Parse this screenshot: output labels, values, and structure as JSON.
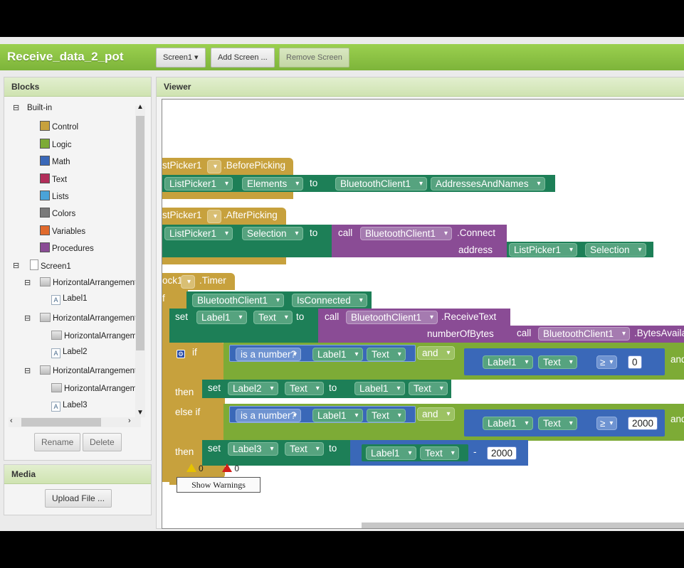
{
  "project": {
    "name": "Receive_data_2_pot"
  },
  "toolbar": {
    "screen_select": "Screen1 ▾",
    "add_screen": "Add Screen ...",
    "remove_screen": "Remove Screen"
  },
  "blocks_panel": {
    "title": "Blocks",
    "builtin_label": "Built-in",
    "builtin": [
      {
        "label": "Control",
        "color": "#c7a13d"
      },
      {
        "label": "Logic",
        "color": "#7dab36"
      },
      {
        "label": "Math",
        "color": "#3a68b8"
      },
      {
        "label": "Text",
        "color": "#b22e5a"
      },
      {
        "label": "Lists",
        "color": "#4aa3d8"
      },
      {
        "label": "Colors",
        "color": "#7a7a7a"
      },
      {
        "label": "Variables",
        "color": "#e06a2c"
      },
      {
        "label": "Procedures",
        "color": "#8a4c95"
      }
    ],
    "components": {
      "screen": "Screen1",
      "ha1": "HorizontalArrangement",
      "label1": "Label1",
      "ha2": "HorizontalArrangement",
      "ha2_child": "HorizontalArrangement",
      "label2": "Label2",
      "ha3": "HorizontalArrangement",
      "ha3_child": "HorizontalArrangement",
      "label3": "Label3"
    },
    "rename_label": "Rename",
    "delete_label": "Delete"
  },
  "media_panel": {
    "title": "Media",
    "upload_label": "Upload File ..."
  },
  "viewer": {
    "title": "Viewer",
    "event1": {
      "component": "stPicker1",
      "event": ".BeforePicking",
      "set_comp": "ListPicker1",
      "set_prop": "Elements",
      "to": "to",
      "get_comp": "BluetoothClient1",
      "get_prop": "AddressesAndNames"
    },
    "event2": {
      "component": "stPicker1",
      "event": ".AfterPicking",
      "set_comp": "ListPicker1",
      "set_prop": "Selection",
      "to": "to",
      "call": "call",
      "call_comp": "BluetoothClient1",
      "call_method": ".Connect",
      "arg_label": "address",
      "arg_comp": "ListPicker1",
      "arg_prop": "Selection"
    },
    "event3": {
      "component": "ock1",
      "event": ".Timer",
      "if_label": "f",
      "cond_comp": "BluetoothClient1",
      "cond_prop": "IsConnected",
      "set_label": "set",
      "set_comp": "Label1",
      "set_prop": "Text",
      "to": "to",
      "call": "call",
      "call_comp": "BluetoothClient1",
      "call_method": ".ReceiveText",
      "arg_label": "numberOfBytes",
      "arg_call": "call",
      "arg_call_comp": "BluetoothClient1",
      "arg_call_method": ".BytesAvaila",
      "inner_if": "if",
      "is_number": "is a number?",
      "num_comp": "Label1",
      "num_prop": "Text",
      "and": "and",
      "cmp_comp": "Label1",
      "cmp_prop": "Text",
      "cmp_op": "≥",
      "cmp_val": "0",
      "and2": "and",
      "then1": "then",
      "then1_set": "set",
      "then1_comp": "Label2",
      "then1_prop": "Text",
      "then1_to": "to",
      "then1_get_comp": "Label1",
      "then1_get_prop": "Text",
      "else_if": "else if",
      "is_number2": "is a number?",
      "num_comp2": "Label1",
      "num_prop2": "Text",
      "and3": "and",
      "cmp_comp2": "Label1",
      "cmp_prop2": "Text",
      "cmp_op2": "≥",
      "cmp_val2": "2000",
      "and4": "and",
      "then2": "then",
      "then2_set": "set",
      "then2_comp": "Label3",
      "then2_prop": "Text",
      "then2_to": "to",
      "sub_comp": "Label1",
      "sub_prop": "Text",
      "minus": "-",
      "sub_val": "2000"
    },
    "warnings": {
      "warn_count": "0",
      "error_count": "0",
      "show_label": "Show Warnings"
    }
  }
}
